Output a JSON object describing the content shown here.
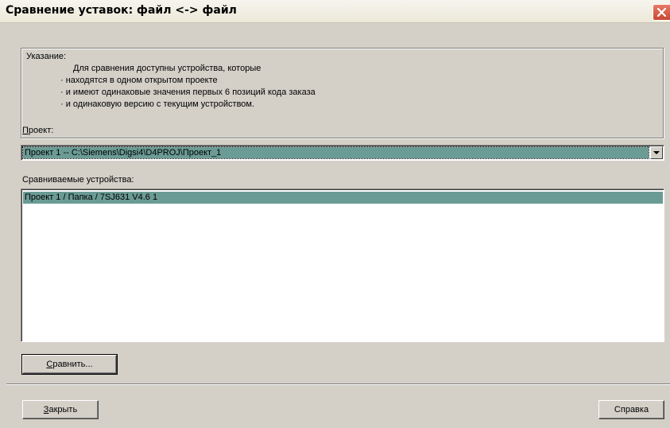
{
  "window": {
    "title": "Сравнение уставок: файл <-> файл"
  },
  "hint": {
    "title": "Указание:",
    "lines": [
      "Для сравнения доступны устройства, которые",
      "· находятся в одном открытом проекте",
      "· и имеют одинаковые значения первых 6 позиций кода заказа",
      "· и одинаковую версию с текущим устройством."
    ]
  },
  "project": {
    "label_hotkey": "П",
    "label_rest": "роект:",
    "selected": "Проект 1 -- C:\\Siemens\\Digsi4\\D4PROJ\\Проект_1"
  },
  "devices": {
    "label": "Сравниваемые устройства:",
    "items": [
      "Проект 1 / Папка / 7SJ631 V4.6 1"
    ]
  },
  "buttons": {
    "compare_hotkey": "С",
    "compare_rest": "равнить...",
    "close_hotkey": "З",
    "close_rest": "акрыть",
    "help": "Справка"
  },
  "colors": {
    "selection": "#6b9b95",
    "close_button": "#c8472f",
    "dialog_face": "#d4d0c8"
  },
  "icons": {
    "close": "close-x-icon",
    "dropdown": "chevron-down-icon"
  }
}
